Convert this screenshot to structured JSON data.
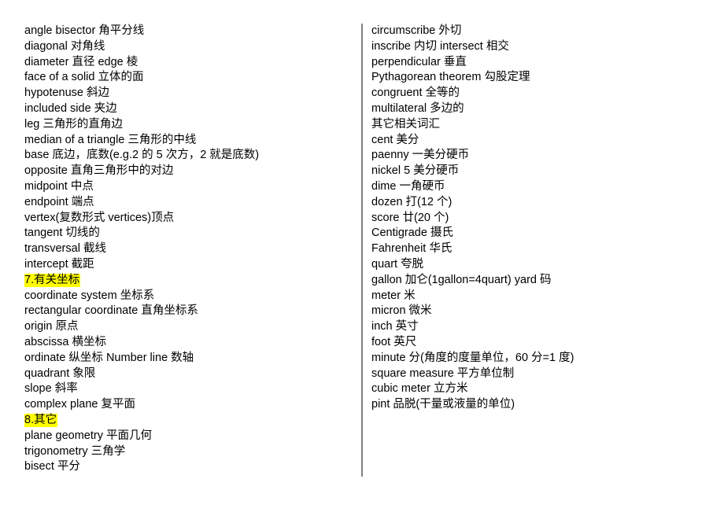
{
  "left_column": {
    "lines": [
      {
        "text": "angle bisector 角平分线",
        "highlight": false
      },
      {
        "text": "diagonal 对角线",
        "highlight": false
      },
      {
        "text": "diameter 直径  edge 棱",
        "highlight": false
      },
      {
        "text": "face of a solid 立体的面",
        "highlight": false
      },
      {
        "text": "hypotenuse 斜边",
        "highlight": false
      },
      {
        "text": "included side 夹边",
        "highlight": false
      },
      {
        "text": "leg 三角形的直角边",
        "highlight": false
      },
      {
        "text": "median of a triangle 三角形的中线",
        "highlight": false
      },
      {
        "text": "base 底边，底数(e.g.2 的 5 次方，2 就是底数)",
        "highlight": false
      },
      {
        "text": "opposite 直角三角形中的对边",
        "highlight": false
      },
      {
        "text": "midpoint 中点",
        "highlight": false
      },
      {
        "text": "endpoint 端点",
        "highlight": false
      },
      {
        "text": "vertex(复数形式 vertices)顶点",
        "highlight": false
      },
      {
        "text": "tangent 切线的",
        "highlight": false
      },
      {
        "text": "transversal 截线",
        "highlight": false
      },
      {
        "text": "intercept 截距",
        "highlight": false
      },
      {
        "text": "7.有关坐标",
        "highlight": true
      },
      {
        "text": "coordinate system 坐标系",
        "highlight": false
      },
      {
        "text": "rectangular coordinate 直角坐标系",
        "highlight": false
      },
      {
        "text": "origin 原点",
        "highlight": false
      },
      {
        "text": "abscissa 横坐标",
        "highlight": false
      },
      {
        "text": "ordinate 纵坐标  Number line 数轴",
        "highlight": false
      },
      {
        "text": "quadrant 象限",
        "highlight": false
      },
      {
        "text": "slope 斜率",
        "highlight": false
      },
      {
        "text": "complex plane 复平面",
        "highlight": false
      },
      {
        "text": "8.其它",
        "highlight": true
      },
      {
        "text": "plane geometry 平面几何",
        "highlight": false
      },
      {
        "text": "trigonometry 三角学",
        "highlight": false
      },
      {
        "text": "bisect 平分",
        "highlight": false
      }
    ]
  },
  "right_column": {
    "lines": [
      {
        "text": "circumscribe 外切",
        "highlight": false
      },
      {
        "text": "inscribe 内切  intersect 相交",
        "highlight": false
      },
      {
        "text": "perpendicular 垂直",
        "highlight": false
      },
      {
        "text": "Pythagorean theorem 勾股定理",
        "highlight": false
      },
      {
        "text": "congruent 全等的",
        "highlight": false
      },
      {
        "text": "multilateral 多边的",
        "highlight": false
      },
      {
        "text": "其它相关词汇",
        "highlight": false
      },
      {
        "text": "cent 美分",
        "highlight": false
      },
      {
        "text": "paenny 一美分硬币",
        "highlight": false
      },
      {
        "text": "nickel 5 美分硬币",
        "highlight": false
      },
      {
        "text": "dime 一角硬币",
        "highlight": false
      },
      {
        "text": "dozen 打(12 个)",
        "highlight": false
      },
      {
        "text": "score 廿(20 个)",
        "highlight": false
      },
      {
        "text": "Centigrade 摄氏",
        "highlight": false
      },
      {
        "text": "Fahrenheit 华氏",
        "highlight": false
      },
      {
        "text": "quart 夸脱",
        "highlight": false
      },
      {
        "text": "gallon 加仑(1gallon=4quart) yard 码",
        "highlight": false
      },
      {
        "text": "meter 米",
        "highlight": false
      },
      {
        "text": "micron 微米",
        "highlight": false
      },
      {
        "text": "inch 英寸",
        "highlight": false
      },
      {
        "text": "foot 英尺",
        "highlight": false
      },
      {
        "text": "minute 分(角度的度量单位，60 分=1 度)",
        "highlight": false
      },
      {
        "text": "square measure 平方单位制",
        "highlight": false
      },
      {
        "text": "cubic meter 立方米",
        "highlight": false
      },
      {
        "text": "pint 品脱(干量或液量的单位)",
        "highlight": false
      }
    ]
  },
  "colors": {
    "text": "#000000",
    "highlight": "#ffff00",
    "divider": "#808080",
    "background": "#ffffff"
  }
}
